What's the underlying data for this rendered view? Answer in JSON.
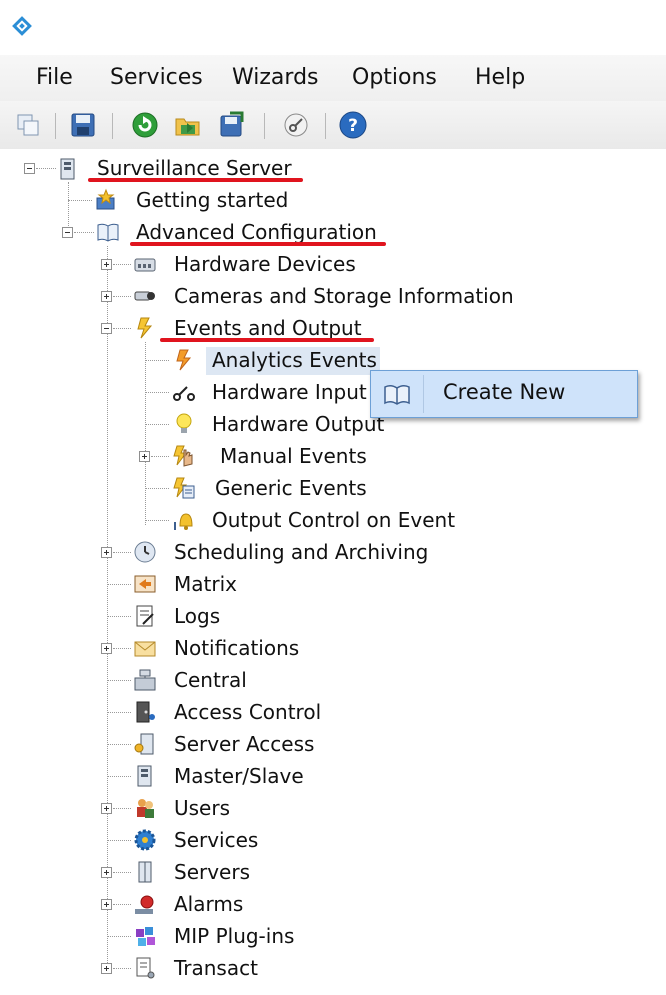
{
  "menu": [
    "File",
    "Services",
    "Wizards",
    "Options",
    "Help"
  ],
  "toolbar": {
    "buttons": [
      "copy-icon",
      "save-icon",
      "refresh-icon",
      "open-folder-icon",
      "export-icon",
      "key-icon",
      "help-icon"
    ]
  },
  "tree": {
    "root": "Surveillance Server",
    "getting_started": "Getting started",
    "advanced": "Advanced Configuration",
    "items": {
      "hardware_devices": "Hardware Devices",
      "cameras_storage": "Cameras and Storage Information",
      "events_output": "Events and Output",
      "analytics_events": "Analytics Events",
      "hardware_input": "Hardware Input",
      "hardware_output": "Hardware Output",
      "manual_events": "Manual Events",
      "generic_events": "Generic Events",
      "output_control": "Output Control on Event",
      "scheduling": "Scheduling and Archiving",
      "matrix": "Matrix",
      "logs": "Logs",
      "notifications": "Notifications",
      "central": "Central",
      "access_control": "Access Control",
      "server_access": "Server Access",
      "master_slave": "Master/Slave",
      "users": "Users",
      "services": "Services",
      "servers": "Servers",
      "alarms": "Alarms",
      "mip_plugins": "MIP Plug-ins",
      "transact": "Transact"
    }
  },
  "context_menu": {
    "create_new": "Create New"
  },
  "colors": {
    "highlight_underline": "#e0141e",
    "selection": "#dde7f3",
    "context_menu_bg": "#cfe3fa"
  }
}
